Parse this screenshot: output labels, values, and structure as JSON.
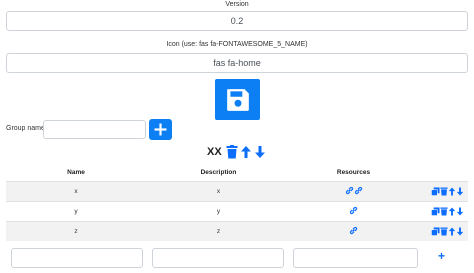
{
  "version": {
    "label": "Version",
    "value": "0.2"
  },
  "icon": {
    "label": "Icon (use: fas fa-FONTAWESOME_5_NAME)",
    "value": "fas fa-home",
    "preview": "floppy-disk-icon",
    "accent": "#0d7ff5"
  },
  "group": {
    "label": "Group name",
    "input_value": "",
    "add_button": "plus-icon",
    "name": "XX"
  },
  "table": {
    "headers": [
      "Name",
      "Description",
      "Resources",
      ""
    ],
    "rows": [
      {
        "name": "x",
        "description": "x",
        "resources": 2
      },
      {
        "name": "y",
        "description": "y",
        "resources": 1
      },
      {
        "name": "z",
        "description": "z",
        "resources": 1
      }
    ]
  },
  "new_row": {
    "add_label": "+"
  }
}
